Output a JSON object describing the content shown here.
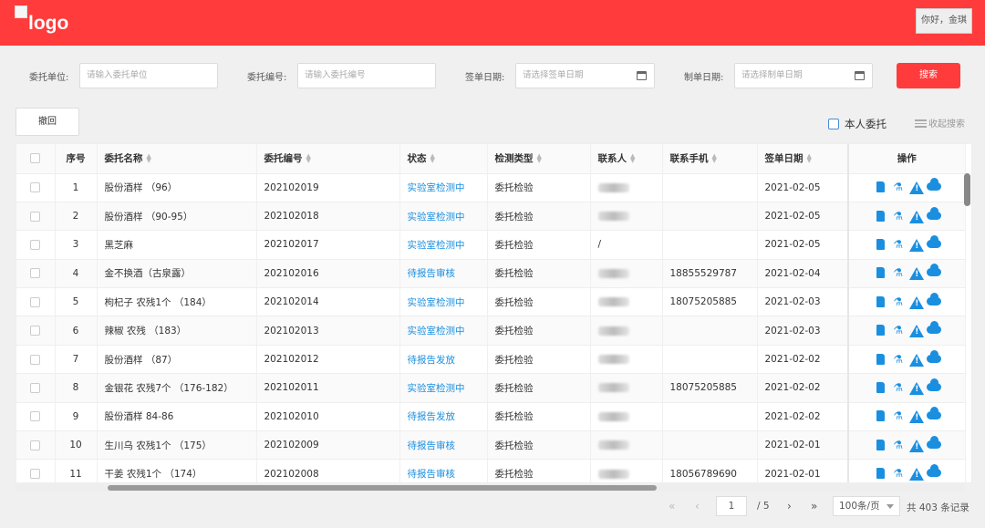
{
  "header": {
    "logo_text": "logo",
    "user_greeting": "你好，金琪"
  },
  "search": {
    "client_unit_label": "委托单位:",
    "client_unit_placeholder": "请输入委托单位",
    "order_no_label": "委托编号:",
    "order_no_placeholder": "请输入委托编号",
    "sign_date_label": "签单日期:",
    "sign_date_placeholder": "请选择签单日期",
    "make_date_label": "制单日期:",
    "make_date_placeholder": "请选择制单日期",
    "search_label": "搜索"
  },
  "toolbar": {
    "revoke_label": "撤回",
    "mine_label": "本人委托",
    "collapse_label": "收起搜索"
  },
  "table": {
    "headers": {
      "index": "序号",
      "name": "委托名称",
      "order_no": "委托编号",
      "status": "状态",
      "type": "检测类型",
      "contact": "联系人",
      "phone": "联系手机",
      "sign_date": "签单日期",
      "ops": "操作"
    },
    "rows": [
      {
        "index": "1",
        "name": "股份酒样 （96）",
        "order_no": "202102019",
        "status": "实验室检测中",
        "type": "委托检验",
        "contact_visible": "",
        "phone": "",
        "sign_date": "2021-02-05"
      },
      {
        "index": "2",
        "name": "股份酒样 （90-95）",
        "order_no": "202102018",
        "status": "实验室检测中",
        "type": "委托检验",
        "contact_visible": "",
        "phone": "",
        "sign_date": "2021-02-05"
      },
      {
        "index": "3",
        "name": "黑芝麻",
        "order_no": "202102017",
        "status": "实验室检测中",
        "type": "委托检验",
        "contact_visible": "/",
        "phone": "",
        "sign_date": "2021-02-05"
      },
      {
        "index": "4",
        "name": "金不换酒（古泉露）",
        "order_no": "202102016",
        "status": "待报告审核",
        "type": "委托检验",
        "contact_visible": "",
        "phone": "18855529787",
        "sign_date": "2021-02-04"
      },
      {
        "index": "5",
        "name": "枸杞子 农残1个 （184）",
        "order_no": "202102014",
        "status": "实验室检测中",
        "type": "委托检验",
        "contact_visible": "",
        "phone": "18075205885",
        "sign_date": "2021-02-03"
      },
      {
        "index": "6",
        "name": "辣椒 农残 （183）",
        "order_no": "202102013",
        "status": "实验室检测中",
        "type": "委托检验",
        "contact_visible": "",
        "phone": "",
        "sign_date": "2021-02-03"
      },
      {
        "index": "7",
        "name": "股份酒样 （87）",
        "order_no": "202102012",
        "status": "待报告发放",
        "type": "委托检验",
        "contact_visible": "",
        "phone": "",
        "sign_date": "2021-02-02"
      },
      {
        "index": "8",
        "name": "金银花 农残7个 （176-182）",
        "order_no": "202102011",
        "status": "实验室检测中",
        "type": "委托检验",
        "contact_visible": "",
        "phone": "18075205885",
        "sign_date": "2021-02-02"
      },
      {
        "index": "9",
        "name": "股份酒样 84-86",
        "order_no": "202102010",
        "status": "待报告发放",
        "type": "委托检验",
        "contact_visible": "",
        "phone": "",
        "sign_date": "2021-02-02"
      },
      {
        "index": "10",
        "name": "生川乌 农残1个 （175）",
        "order_no": "202102009",
        "status": "待报告审核",
        "type": "委托检验",
        "contact_visible": "",
        "phone": "",
        "sign_date": "2021-02-01"
      },
      {
        "index": "11",
        "name": "干姜 农残1个 （174）",
        "order_no": "202102008",
        "status": "待报告审核",
        "type": "委托检验",
        "contact_visible": "",
        "phone": "18056789690",
        "sign_date": "2021-02-01"
      }
    ]
  },
  "pagination": {
    "current_page": "1",
    "total_pages": "/ 5",
    "page_size": "100条/页",
    "total": "共 403 条记录"
  },
  "colors": {
    "brand_red": "#ff3b3b",
    "status_blue": "#1a8fe0"
  },
  "icons": [
    "document-icon",
    "flask-icon",
    "warning-icon",
    "cloud-icon"
  ]
}
